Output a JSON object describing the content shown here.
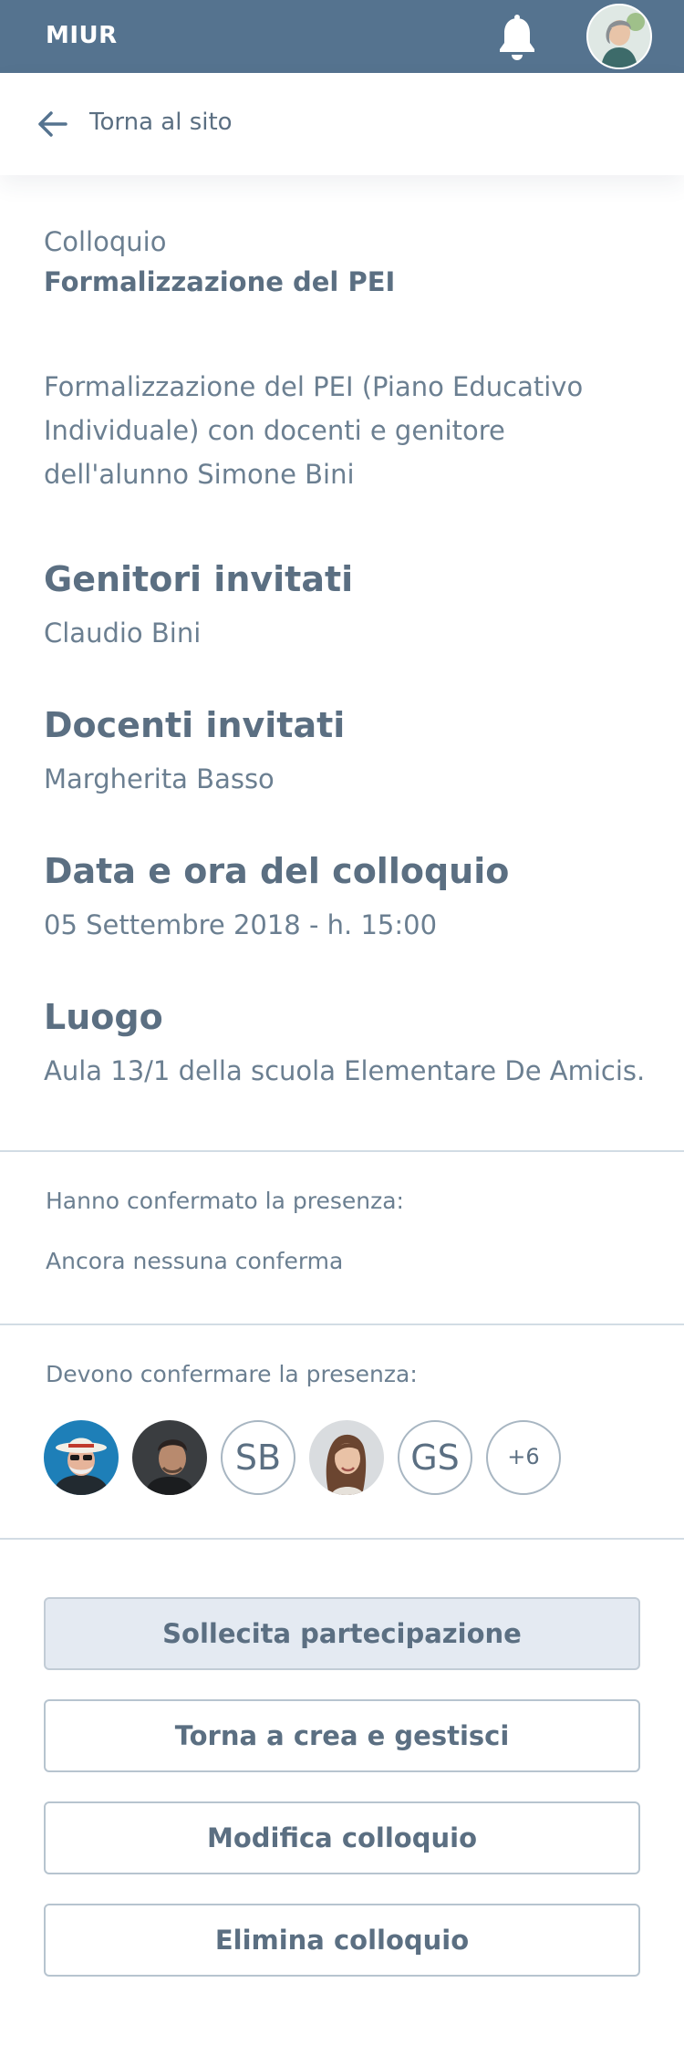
{
  "header": {
    "brand": "MIUR",
    "icons": {
      "notifications": "bell-icon",
      "profile": "user-avatar"
    },
    "color": "#55738f"
  },
  "back": {
    "label": "Torna al sito",
    "icon": "arrow-left-icon"
  },
  "meeting": {
    "type": "Colloquio",
    "title": "Formalizzazione del PEI",
    "description": "Formalizzazione del PEI (Piano Educativo Individuale) con docenti e genitore dell'alunno Simone Bini"
  },
  "sections": {
    "parents": {
      "title": "Genitori invitati",
      "value": "Claudio Bini"
    },
    "teachers": {
      "title": "Docenti invitati",
      "value": "Margherita Basso"
    },
    "datetime": {
      "title": "Data e ora del colloquio",
      "value": "05 Settembre 2018 - h. 15:00"
    },
    "place": {
      "title": "Luogo",
      "value": "Aula 13/1 della scuola Elementare De Amicis."
    }
  },
  "confirmed": {
    "label": "Hanno confermato la presenza:",
    "value": "Ancora nessuna conferma"
  },
  "pending": {
    "label": "Devono confermare la presenza:",
    "avatars": [
      {
        "kind": "photo",
        "name": "avatar-man-hat"
      },
      {
        "kind": "photo",
        "name": "avatar-man-dark"
      },
      {
        "kind": "initials",
        "initials": "SB"
      },
      {
        "kind": "photo",
        "name": "avatar-woman"
      },
      {
        "kind": "initials",
        "initials": "GS"
      },
      {
        "kind": "more",
        "count": "+6"
      }
    ]
  },
  "actions": {
    "remind": "Sollecita partecipazione",
    "back_manage": "Torna a crea e gestisci",
    "edit": "Modifica colloquio",
    "delete": "Elimina colloquio"
  },
  "colors": {
    "text": "#5b6f82",
    "accent": "#55738f",
    "primary_button_bg": "#e4eaf2"
  }
}
